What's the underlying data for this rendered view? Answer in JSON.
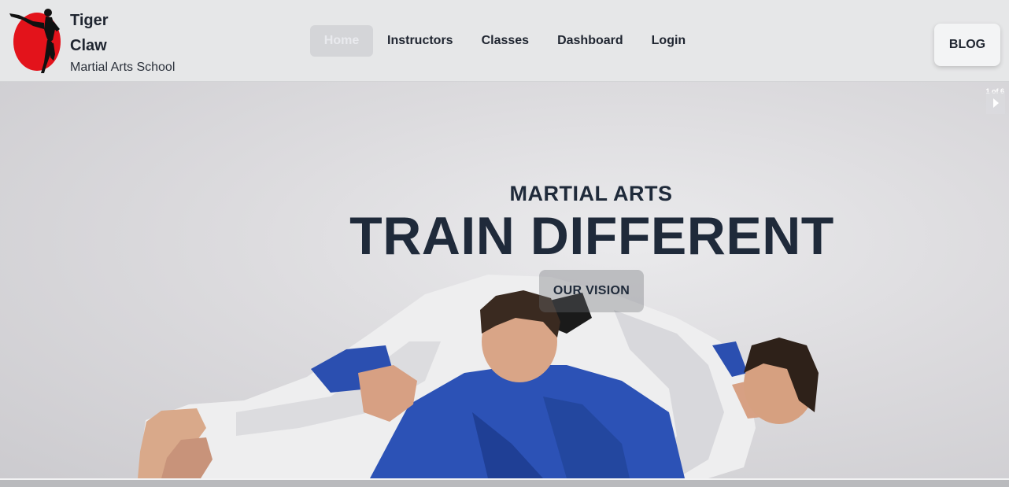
{
  "header": {
    "brand_line1": "Tiger",
    "brand_line2": "Claw",
    "brand_sub": "Martial Arts School",
    "logo_icon": "karate-kick-silhouette-icon",
    "logo_color": "#e3131b"
  },
  "nav": {
    "items": [
      {
        "label": "Home",
        "active": true
      },
      {
        "label": "Instructors",
        "active": false
      },
      {
        "label": "Classes",
        "active": false
      },
      {
        "label": "Dashboard",
        "active": false
      },
      {
        "label": "Login",
        "active": false
      }
    ]
  },
  "blog_button": "BLOG",
  "hero": {
    "subtitle": "MARTIAL ARTS",
    "title": "TRAIN DIFFERENT",
    "cta": "OUR VISION",
    "slide_counter": "1 of 6",
    "next_icon": "chevron-right-icon",
    "text_color": "#1f2a3a"
  }
}
